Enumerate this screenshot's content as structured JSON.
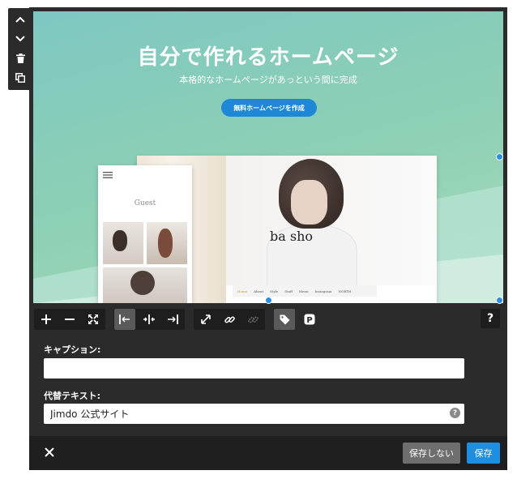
{
  "side_toolbar": {
    "items": [
      {
        "icon": "chevron-up-icon"
      },
      {
        "icon": "chevron-down-icon"
      },
      {
        "icon": "trash-icon"
      },
      {
        "icon": "duplicate-icon"
      }
    ]
  },
  "image": {
    "hero_title": "自分で作れるホームページ",
    "hero_subtitle": "本格的なホームページがあっという間に完成",
    "hero_cta": "無料ホームページを作成",
    "mobile_guest": "Guest",
    "desktop_brand": "ba sho",
    "desktop_nav": [
      "Home",
      "About",
      "Style",
      "Staff",
      "Menu",
      "Instagram",
      "NORTH"
    ]
  },
  "toolbar": {
    "icons": [
      "plus-icon",
      "minus-icon",
      "expand-icon",
      "align-left-icon",
      "align-center-icon",
      "align-right-icon",
      "fullscreen-icon",
      "link-icon",
      "unlink-icon",
      "tag-icon",
      "pinterest-icon",
      "help-icon"
    ],
    "help_label": "?"
  },
  "caption": {
    "label": "キャプション:",
    "value": ""
  },
  "alt_text": {
    "label": "代替テキスト:",
    "value": "Jimdo 公式サイト",
    "help": "?"
  },
  "footer": {
    "cancel_label": "保存しない",
    "save_label": "保存"
  },
  "colors": {
    "panel": "#2b2b2b",
    "save_blue": "#1e8ee0",
    "hero_teal": "#7ec8c2"
  }
}
